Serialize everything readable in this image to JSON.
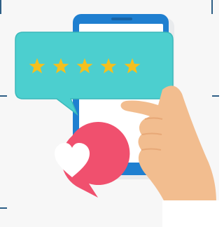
{
  "illustration": {
    "subject": "phone-review",
    "rating": {
      "filled": 5,
      "max": 5
    },
    "colors": {
      "background": "#f7f7f7",
      "phone_body": "#1f7fd0",
      "phone_screen": "#ffffff",
      "review_bubble": "#4ccfcf",
      "review_bubble_border": "#3bb9bb",
      "star": "#f4c01e",
      "heart_bubble": "#f0506e",
      "heart": "#ffffff",
      "skin": "#f2bd8f",
      "skin_shadow": "#e7a877",
      "sleeve": "#ffffff",
      "frame": "#2e5f86"
    }
  }
}
